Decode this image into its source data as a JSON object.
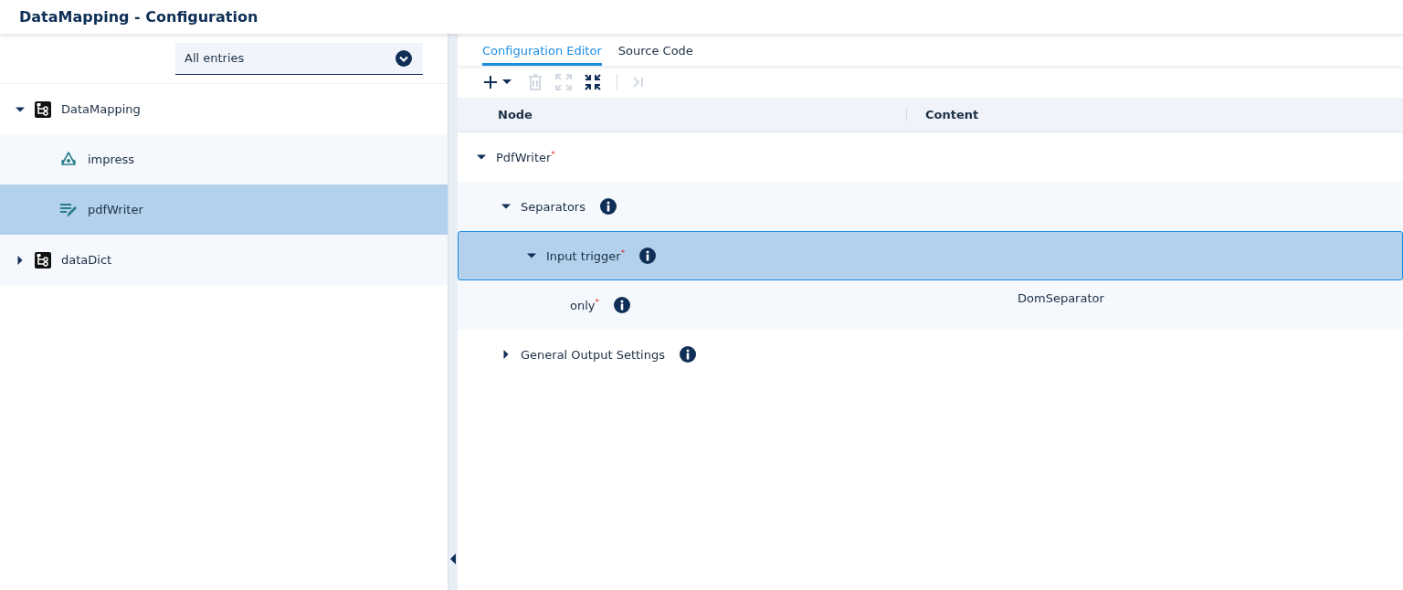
{
  "window": {
    "title": "DataMapping - Configuration"
  },
  "filter": {
    "value": "All entries"
  },
  "sidebar_tree": [
    {
      "label": "DataMapping",
      "kind": "mapping",
      "expanded": true,
      "selected": false,
      "children": [
        {
          "label": "impress",
          "kind": "impress",
          "selected": false
        },
        {
          "label": "pdfWriter",
          "kind": "writer",
          "selected": true
        }
      ]
    },
    {
      "label": "dataDict",
      "kind": "mapping",
      "expanded": false,
      "selected": false
    }
  ],
  "tabs": [
    {
      "label": "Configuration Editor",
      "selected": true
    },
    {
      "label": "Source Code",
      "selected": false
    }
  ],
  "toolbar": [
    {
      "kind": "add",
      "disabled": false
    },
    {
      "kind": "delete",
      "disabled": true
    },
    {
      "kind": "expand",
      "disabled": true
    },
    {
      "kind": "collapse",
      "disabled": false
    },
    {
      "kind": "separator"
    },
    {
      "kind": "skip",
      "disabled": true
    }
  ],
  "table": {
    "columns": [
      "Node",
      "Content"
    ],
    "tree": [
      {
        "label": "PdfWriter$^{*}$",
        "info": false,
        "expanded": true,
        "selected": false,
        "children": [
          {
            "label": "Separators",
            "info": true,
            "expanded": true,
            "selected": false,
            "children": [
              {
                "label": "Input trigger$^{*}$",
                "info": true,
                "expanded": true,
                "selected": true,
                "children": [
                  {
                    "label": "only$^{*}$",
                    "info": true,
                    "selected": false,
                    "content": "DomSeparator"
                  }
                ]
              }
            ]
          },
          {
            "label": "General Output Settings",
            "info": true,
            "expanded": false,
            "selected": false
          }
        ]
      }
    ]
  }
}
